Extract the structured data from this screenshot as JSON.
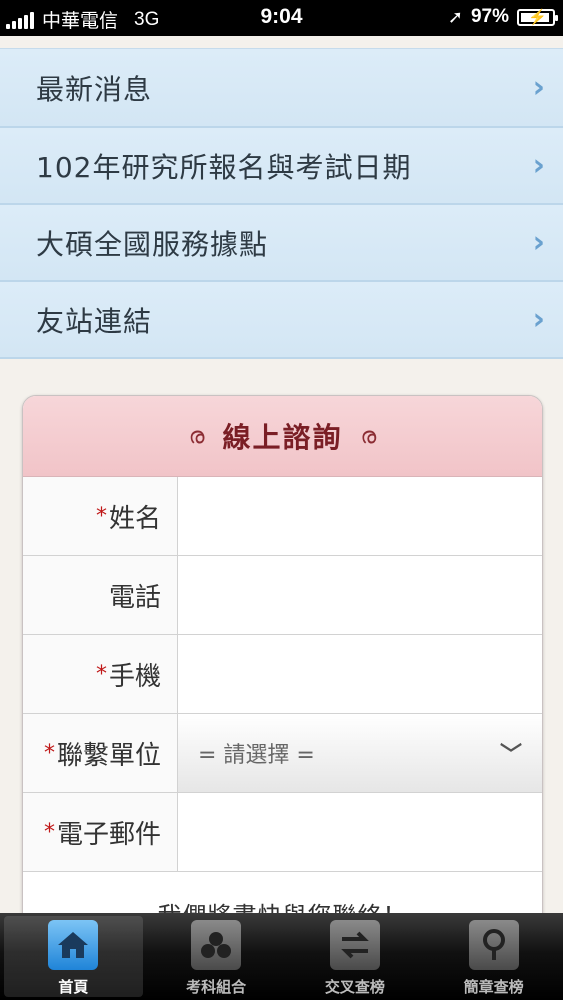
{
  "status_bar": {
    "carrier": "中華電信",
    "network": "3G",
    "time": "9:04",
    "battery": "97%"
  },
  "menu": {
    "items": [
      {
        "label": "最新消息"
      },
      {
        "label": "102年研究所報名與考試日期"
      },
      {
        "label": "大碩全國服務據點"
      },
      {
        "label": "友站連結"
      }
    ]
  },
  "form": {
    "title": "線上諮詢",
    "required_mark": "*",
    "fields": {
      "name": {
        "label": "姓名"
      },
      "phone": {
        "label": "電話"
      },
      "mobile": {
        "label": "手機"
      },
      "unit": {
        "label": "聯繫單位",
        "selected": "= 請選擇 ="
      },
      "email": {
        "label": "電子郵件"
      }
    },
    "note": "我們將盡快與您聯絡！"
  },
  "tabbar": {
    "tabs": [
      {
        "label": "首頁",
        "icon": "home-icon"
      },
      {
        "label": "考科組合",
        "icon": "cluster-icon"
      },
      {
        "label": "交叉查榜",
        "icon": "swap-icon"
      },
      {
        "label": "簡章查榜",
        "icon": "magnifier-icon"
      }
    ]
  }
}
